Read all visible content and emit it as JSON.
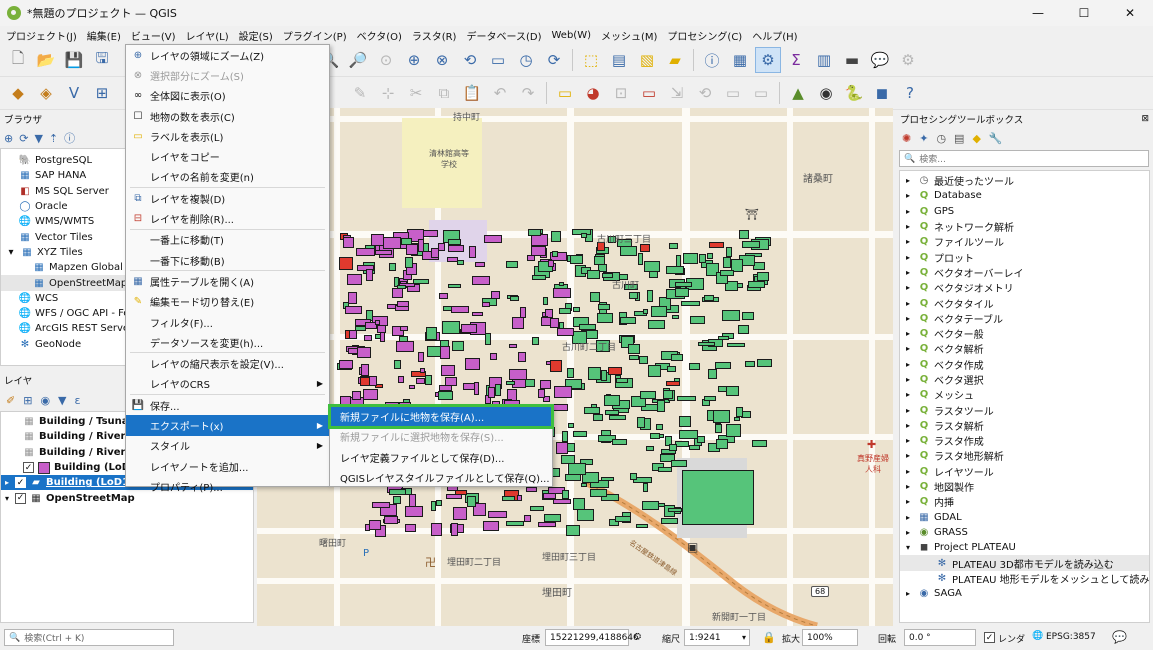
{
  "window": {
    "title": "*無題のプロジェクト — QGIS",
    "minimize": "—",
    "maximize": "☐",
    "close": "✕"
  },
  "menubar": [
    "プロジェクト(J)",
    "編集(E)",
    "ビュー(V)",
    "レイヤ(L)",
    "設定(S)",
    "プラグイン(P)",
    "ベクタ(O)",
    "ラスタ(R)",
    "データベース(D)",
    "Web(W)",
    "メッシュ(M)",
    "プロセシング(C)",
    "ヘルプ(H)"
  ],
  "browser": {
    "title": "ブラウザ",
    "items": [
      "PostgreSQL",
      "SAP HANA",
      "MS SQL Server",
      "Oracle",
      "WMS/WMTS",
      "Vector Tiles",
      "XYZ Tiles",
      "Mapzen Global T",
      "OpenStreetMap",
      "WCS",
      "WFS / OGC API - Fe",
      "ArcGIS REST Servers",
      "GeoNode"
    ]
  },
  "layers": {
    "title": "レイヤ",
    "items": [
      "Building / Tsunami",
      "Building / RiverFloo",
      "Building / RiverFloo",
      "Building (LoD2",
      "Building (LoD1",
      "OpenStreetMap"
    ]
  },
  "context_menu": {
    "items": [
      {
        "label": "レイヤの領域にズーム(Z)",
        "icon": "zoom-layer-icon",
        "disabled": false
      },
      {
        "label": "選択部分にズーム(S)",
        "icon": "zoom-selection-icon",
        "disabled": true
      },
      {
        "label": "全体図に表示(O)",
        "icon": "overview-icon",
        "disabled": false
      },
      {
        "label": "地物の数を表示(C)",
        "icon": "checkbox-icon",
        "disabled": false
      },
      {
        "label": "ラベルを表示(L)",
        "icon": "label-icon",
        "disabled": false
      },
      {
        "label": "レイヤをコピー",
        "icon": "",
        "disabled": false
      },
      {
        "label": "レイヤの名前を変更(n)",
        "icon": "",
        "disabled": false
      },
      {
        "label": "レイヤを複製(D)",
        "icon": "duplicate-icon",
        "disabled": false
      },
      {
        "label": "レイヤを削除(R)...",
        "icon": "remove-icon",
        "disabled": false
      },
      {
        "label": "一番上に移動(T)",
        "icon": "",
        "disabled": false
      },
      {
        "label": "一番下に移動(B)",
        "icon": "",
        "disabled": false
      },
      {
        "label": "属性テーブルを開く(A)",
        "icon": "table-icon",
        "disabled": false
      },
      {
        "label": "編集モード切り替え(E)",
        "icon": "pencil-icon",
        "disabled": false
      },
      {
        "label": "フィルタ(F)...",
        "icon": "",
        "disabled": false
      },
      {
        "label": "データソースを変更(h)...",
        "icon": "",
        "disabled": false
      },
      {
        "label": "レイヤの縮尺表示を設定(V)...",
        "icon": "",
        "disabled": false
      },
      {
        "label": "レイヤのCRS",
        "icon": "",
        "disabled": false
      },
      {
        "label": "保存...",
        "icon": "save-icon",
        "disabled": false
      },
      {
        "label": "エクスポート(x)",
        "icon": "",
        "disabled": false
      },
      {
        "label": "スタイル",
        "icon": "",
        "disabled": false
      },
      {
        "label": "レイヤノートを追加...",
        "icon": "",
        "disabled": false
      },
      {
        "label": "プロパティ(P)...",
        "icon": "",
        "disabled": false
      }
    ]
  },
  "export_submenu": [
    "新規ファイルに地物を保存(A)...",
    "新規ファイルに選択地物を保存(S)...",
    "レイヤ定義ファイルとして保存(D)...",
    "QGISレイヤスタイルファイルとして保存(Q)..."
  ],
  "map_labels": [
    "持中町",
    "清林館高等学校",
    "諸桑町",
    "古川町三丁目",
    "古川町",
    "古川町二丁目",
    "曙田町",
    "埋田町二丁目",
    "埋田町三丁目",
    "埋田町",
    "新開町一丁目",
    "真野産婦人科",
    "名古屋鉄道津島線",
    "68"
  ],
  "processing": {
    "title": "プロセシングツールボックス",
    "search_placeholder": "検索...",
    "items": [
      "最近使ったツール",
      "Database",
      "GPS",
      "ネットワーク解析",
      "ファイルツール",
      "プロット",
      "ベクタオーバーレイ",
      "ベクタジオメトリ",
      "ベクタタイル",
      "ベクタテーブル",
      "ベクター般",
      "ベクタ解析",
      "ベクタ作成",
      "ベクタ選択",
      "メッシュ",
      "ラスタツール",
      "ラスタ解析",
      "ラスタ作成",
      "ラスタ地形解析",
      "レイヤツール",
      "地図製作",
      "内挿",
      "GDAL",
      "GRASS",
      "Project PLATEAU",
      "PLATEAU 3D都市モデルを読み込む",
      "PLATEAU 地形モデルをメッシュとして読み込む",
      "SAGA"
    ]
  },
  "statusbar": {
    "search_placeholder": "検索(Ctrl + K)",
    "coord_label": "座標",
    "coord_value": "15221299,4188646",
    "scale_label": "縮尺",
    "scale_value": "1:9241",
    "magnifier_label": "拡大",
    "magnifier_value": "100%",
    "rotation_label": "回転",
    "rotation_value": "0.0 °",
    "render_label": "レンダ",
    "crs": "EPSG:3857"
  },
  "colors": {
    "selection": "#1a73c7",
    "highlight_border": "#3fbf3f",
    "building_magenta": "#c75fc9",
    "building_green": "#56c47a",
    "building_red": "#e03a2e"
  }
}
